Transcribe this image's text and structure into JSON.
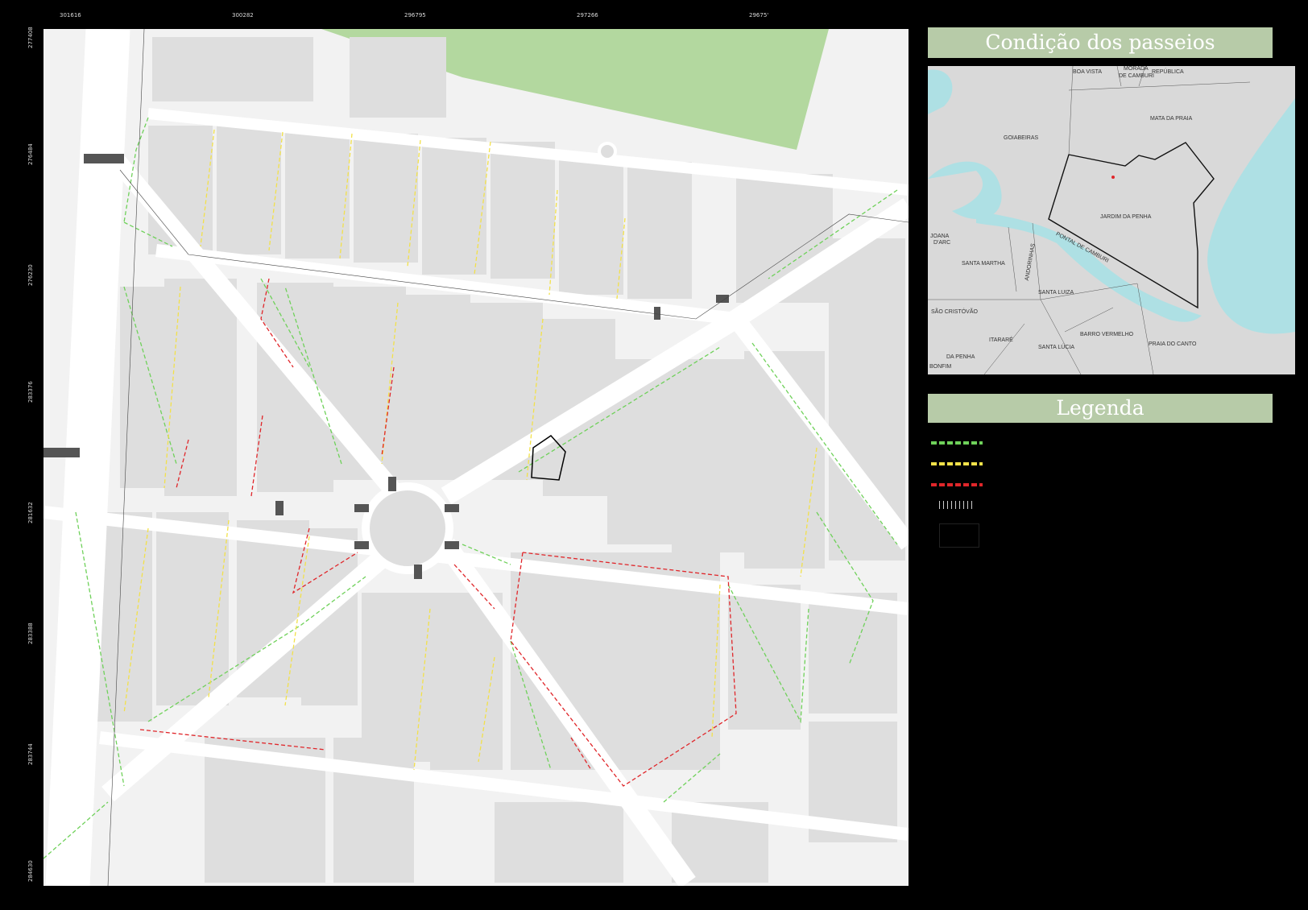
{
  "title": "Condição dos passeios",
  "legend_title": "Legenda",
  "coordinates": {
    "top": [
      "301616",
      "300282",
      "296795",
      "297266",
      "29675'"
    ],
    "left": [
      "277408",
      "276484",
      "276230",
      "283376",
      "281632",
      "283388",
      "283744",
      "284630"
    ]
  },
  "inset_labels": [
    "BOA VISTA",
    "MORADA",
    "DE CAMBURI",
    "REPÚBLICA",
    "MATA DA PRAIA",
    "GOIABEIRAS",
    "JARDIM DA PENHA",
    "JOANA",
    "D'ARC",
    "SANTA MARTHA",
    "ANDORINHAS",
    "PONTAL DE CAMBURI",
    "SANTA LUIZA",
    "SÃO CRISTÓVÃO",
    "ITARARÉ",
    "BARRO VERMELHO",
    "PRAIA DO CANTO",
    "SANTA LÚCIA",
    "DA PENHA",
    "BONFIM"
  ],
  "legend": {
    "colors": {
      "good": "#6fd15a",
      "regular": "#f2e14a",
      "bad": "#e0262a",
      "crossing": "#cccccc",
      "area": "#000000"
    },
    "items": [
      {
        "key": "good",
        "label": ""
      },
      {
        "key": "regular",
        "label": ""
      },
      {
        "key": "bad",
        "label": ""
      },
      {
        "key": "crossing",
        "label": ""
      },
      {
        "key": "area",
        "label": ""
      }
    ]
  },
  "map_colors": {
    "block": "#dedede",
    "park": "#b3d89f",
    "water": "#aee0e4",
    "street": "#ffffff"
  }
}
